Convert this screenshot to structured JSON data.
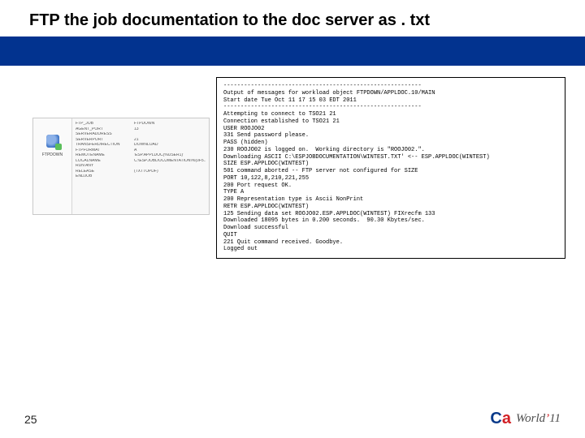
{
  "header": {
    "title": "FTP the job documentation to the doc server as . txt"
  },
  "thumb": {
    "iconLabel": "FTPDOWN",
    "rows": [
      {
        "k": "FTP_JOB",
        "v": "FTPDOWN"
      },
      {
        "k": "AGENT_PORT",
        "v": "13"
      },
      {
        "k": "SERVERADDRESS",
        "v": ""
      },
      {
        "k": "SERVERPORT",
        "v": "21"
      },
      {
        "k": "TRANSFERDIRECTION",
        "v": "DOWNLOAD"
      },
      {
        "k": "FTPFORMAT",
        "v": "A"
      },
      {
        "k": "REMOTENAME",
        "v": "'ESP.APPLDOC(%USER1)'"
      },
      {
        "k": "LOCALNAME",
        "v": "C:\\ESPJOBDOCUMENTATION\\%(0F5.1.TXT"
      },
      {
        "k": "RUN ANY",
        "v": ""
      },
      {
        "k": "RELEASE",
        "v": "(TXTTOPDF)"
      },
      {
        "k": "ENDJOB",
        "v": ""
      }
    ]
  },
  "log": {
    "lines": [
      "----------------------------------------------------------",
      "Output of messages for workload object FTPDOWN/APPLDOC.10/MAIN",
      "Start date Tue Oct 11 17 15 03 EDT 2011",
      "----------------------------------------------------------",
      "Attempting to connect to TSO21 21",
      "Connection established to TSO21 21",
      "USER ROOJO02",
      "331 Send password please.",
      "PASS (hidden)",
      "230 ROOJO02 is logged on.  Working directory is \"ROOJO02.\".",
      "Downloading ASCII C:\\ESPJOBDOCUMENTATION\\WINTEST.TXT' <-- ESP.APPLDOC(WINTEST)",
      "SIZE ESP.APPLDOC(WINTEST)",
      "501 command aborted -- FTP server not configured for SIZE",
      "PORT 10,122,8,210,221,255",
      "200 Port request OK.",
      "TYPE A",
      "200 Representation type is Ascii NonPrint",
      "RETR ESP.APPLDOC(WINTEST)",
      "125 Sending data set ROOJO02.ESP.APPLDOC(WINTEST) FIXrecfm 133",
      "Downloaded 18095 bytes in 0.200 seconds.  90.30 Kbytes/sec.",
      "Download successful",
      "QUIT",
      "221 Quit command received. Goodbye.",
      "Logged out"
    ]
  },
  "footer": {
    "page": "25",
    "logoC": "C",
    "logoA": "a",
    "world": "World",
    "apostrophe": "’",
    "year": "11"
  }
}
